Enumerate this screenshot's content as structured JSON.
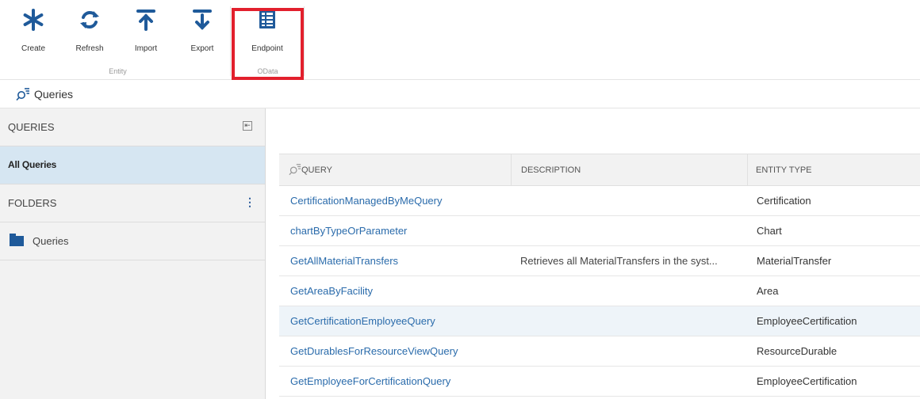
{
  "ribbon": {
    "buttons": [
      {
        "label": "Create",
        "icon": "asterisk-icon"
      },
      {
        "label": "Refresh",
        "icon": "refresh-icon"
      },
      {
        "label": "Import",
        "icon": "import-icon"
      },
      {
        "label": "Export",
        "icon": "export-icon"
      },
      {
        "label": "Endpoint",
        "icon": "endpoint-icon"
      }
    ],
    "groups": {
      "entity": "Entity",
      "odata": "OData"
    },
    "icon_color": "#1f5a9a",
    "highlight_color": "#e2202d"
  },
  "breadcrumb": {
    "title": "Queries",
    "icon": "query-search-icon"
  },
  "sidebar": {
    "queries_header": "QUERIES",
    "all_queries": "All Queries",
    "folders_header": "FOLDERS",
    "folder_item": "Queries",
    "collapse_icon": "collapse-panel-icon",
    "more_icon": "kebab-menu-icon"
  },
  "table": {
    "columns": {
      "query": "QUERY",
      "description": "DESCRIPTION",
      "entity_type": "ENTITY TYPE"
    },
    "rows": [
      {
        "query": "CertificationManagedByMeQuery",
        "description": "",
        "entity_type": "Certification"
      },
      {
        "query": "chartByTypeOrParameter",
        "description": "",
        "entity_type": "Chart"
      },
      {
        "query": "GetAllMaterialTransfers",
        "description": "Retrieves all MaterialTransfers in the syst...",
        "entity_type": "MaterialTransfer"
      },
      {
        "query": "GetAreaByFacility",
        "description": "",
        "entity_type": "Area"
      },
      {
        "query": "GetCertificationEmployeeQuery",
        "description": "",
        "entity_type": "EmployeeCertification"
      },
      {
        "query": "GetDurablesForResourceViewQuery",
        "description": "",
        "entity_type": "ResourceDurable"
      },
      {
        "query": "GetEmployeeForCertificationQuery",
        "description": "",
        "entity_type": "EmployeeCertification"
      }
    ]
  }
}
